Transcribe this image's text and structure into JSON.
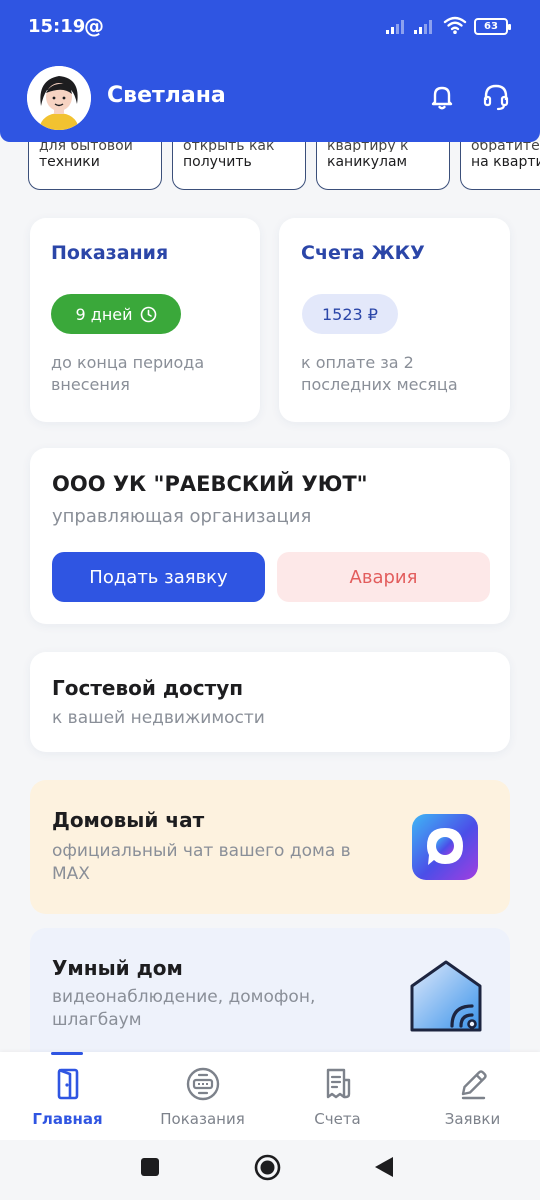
{
  "status_bar": {
    "time": "15:19",
    "at_symbol": "@",
    "battery": "63"
  },
  "header": {
    "user_name": "Светлана",
    "icons": [
      "bell-icon",
      "headset-icon"
    ],
    "color": "#2f55e2"
  },
  "chips": [
    {
      "partial": "для бытовой",
      "label": "техники"
    },
    {
      "partial": "открыть как",
      "label": "получить"
    },
    {
      "partial": "квартиру к",
      "label": "каникулам"
    },
    {
      "partial": "обратите",
      "label": "на квартир"
    }
  ],
  "meter_card": {
    "title": "Показания",
    "badge": "9 дней",
    "description": "до конца периода внесения"
  },
  "bills_card": {
    "title": "Счета ЖКУ",
    "badge": "1523 ₽",
    "description": "к оплате за 2 последних месяца"
  },
  "org_card": {
    "name": "ООО УК \"РАЕВСКИЙ УЮТ\"",
    "subtitle": "управляющая организация",
    "request_button": "Подать заявку",
    "emergency_button": "Авария"
  },
  "guest_card": {
    "title": "Гостевой доступ",
    "subtitle": "к вашей недвижимости"
  },
  "chat_card": {
    "title": "Домовый чат",
    "subtitle": "официальный чат вашего дома в MAX",
    "background": "#fdf2df"
  },
  "smarthome_card": {
    "title": "Умный дом",
    "subtitle": "видеонаблюдение, домофон, шлагбаум",
    "background": "#eef2fb"
  },
  "tabs": [
    {
      "label": "Главная",
      "icon": "door-icon",
      "active": true
    },
    {
      "label": "Показания",
      "icon": "meter-icon",
      "active": false
    },
    {
      "label": "Счета",
      "icon": "receipt-icon",
      "active": false
    },
    {
      "label": "Заявки",
      "icon": "pencil-icon",
      "active": false
    }
  ],
  "nav_bar": [
    "recents-icon",
    "home-icon",
    "back-icon"
  ]
}
